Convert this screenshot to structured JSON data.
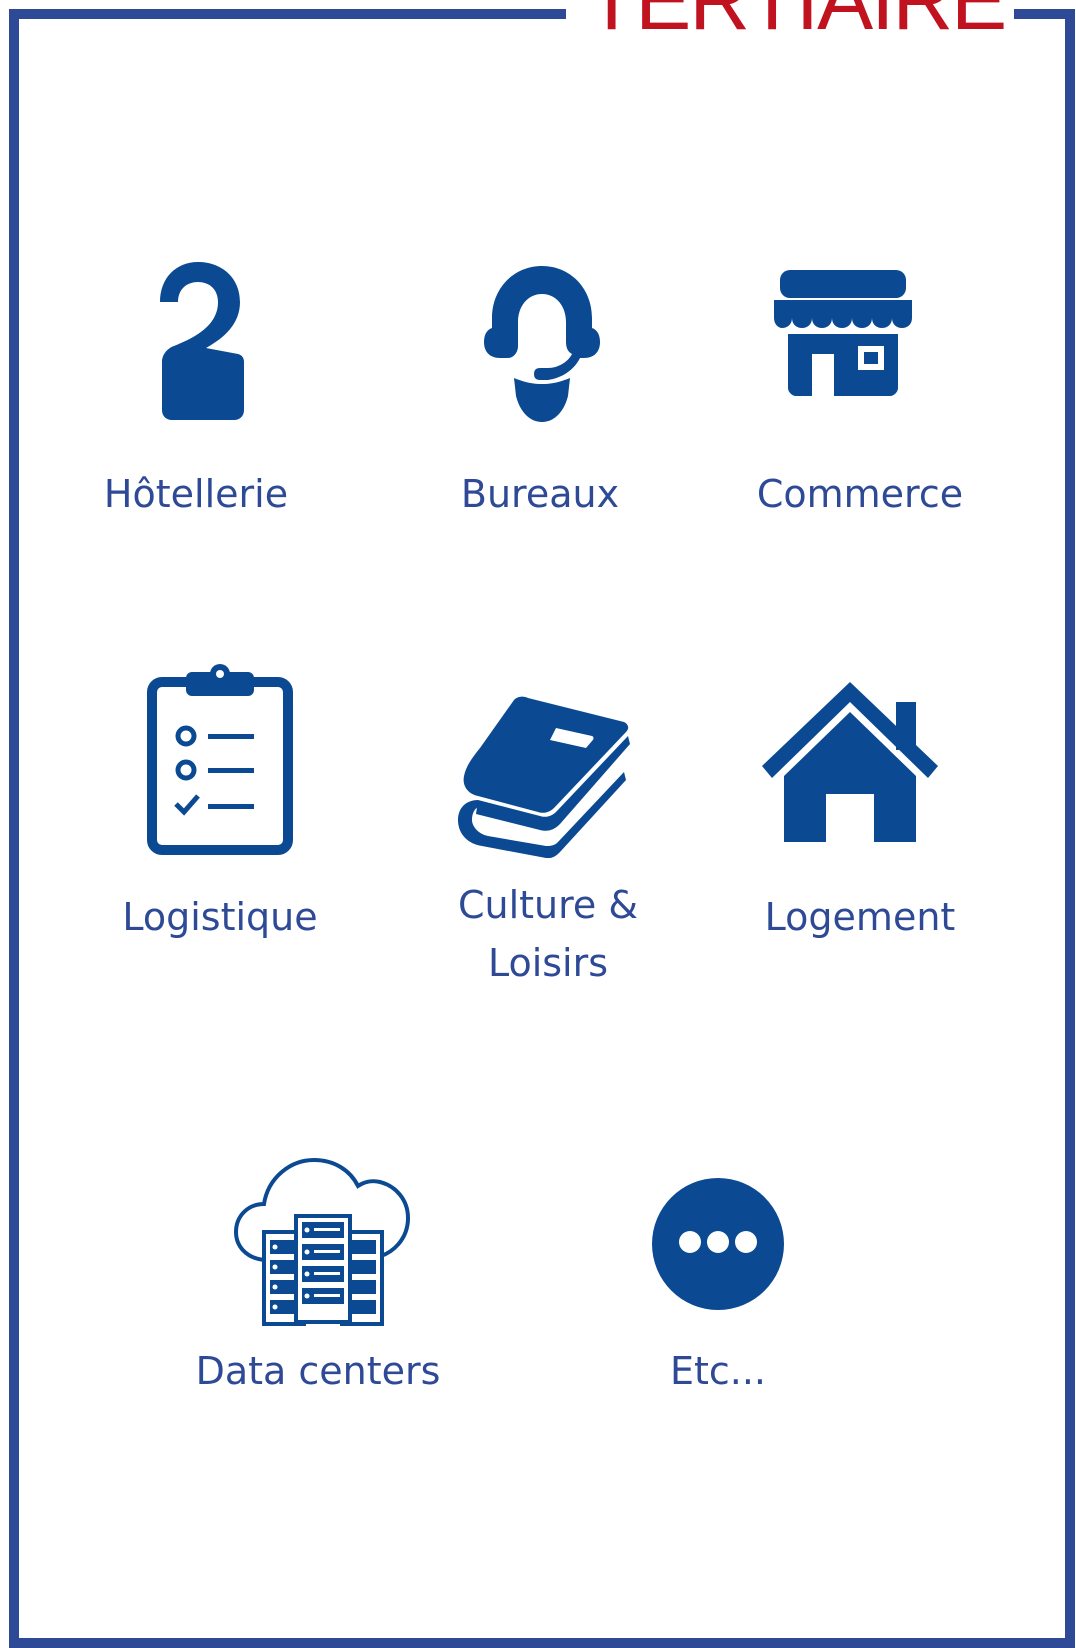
{
  "title": "TERTIAIRE",
  "colors": {
    "border": "#2e4a96",
    "icon": "#0b4a93",
    "label": "#2e4a96",
    "title": "#c1121f"
  },
  "items": [
    {
      "label": "Hôtellerie",
      "icon": "door-hanger-icon"
    },
    {
      "label": "Bureaux",
      "icon": "headset-icon"
    },
    {
      "label": "Commerce",
      "icon": "storefront-icon"
    },
    {
      "label": "Logistique",
      "icon": "clipboard-checklist-icon"
    },
    {
      "label_line1": "Culture &",
      "label_line2": "Loisirs",
      "icon": "book-icon"
    },
    {
      "label": "Logement",
      "icon": "house-icon"
    },
    {
      "label": "Data centers",
      "icon": "cloud-server-icon"
    },
    {
      "label": "Etc...",
      "icon": "more-dots-icon"
    }
  ]
}
